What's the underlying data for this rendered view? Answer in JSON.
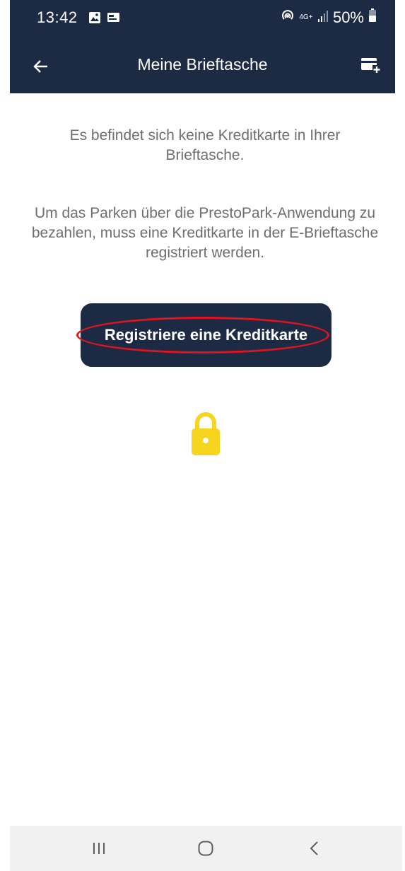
{
  "status_bar": {
    "time": "13:42",
    "battery_text": "50%",
    "network_label": "4G+",
    "icons": [
      "gallery-icon",
      "cast-icon",
      "hotspot-icon",
      "network-4g-icon",
      "signal-icon",
      "battery-icon"
    ]
  },
  "header": {
    "title": "Meine Brieftasche",
    "back_icon": "arrow-left-icon",
    "add_card_icon": "add-card-icon"
  },
  "main": {
    "empty_message": "Es befindet sich keine Kreditkarte in Ihrer Brieftasche.",
    "info_message": "Um das Parken über die PrestoPark-Anwendung zu bezahlen, muss eine Kreditkarte in der E-Brieftasche registriert werden.",
    "register_button_label": "Registriere eine Kreditkarte",
    "lock_icon": "lock-icon"
  },
  "nav_bar": {
    "icons": [
      "recent-apps-icon",
      "home-icon",
      "back-icon"
    ]
  },
  "colors": {
    "primary": "#1d2a44",
    "lock": "#f7d51e",
    "highlight": "#e0141e",
    "text_grey": "#6e6e6e",
    "nav_bg": "#f1f1f1"
  }
}
